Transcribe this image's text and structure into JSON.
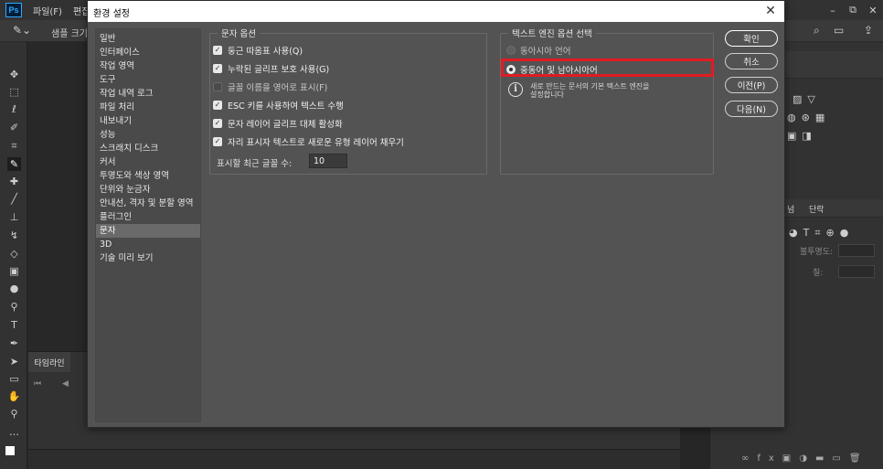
{
  "app": {
    "logo": "Ps",
    "menu": [
      "파일(F)",
      "편집"
    ],
    "window_controls": [
      "–",
      "⧉",
      "✕"
    ],
    "options_bar": {
      "sample_label": "샘플 크기",
      "tool_icon": "eyedropper-icon"
    }
  },
  "timeline": {
    "tab_label": "타임라인",
    "controls": "⏮ ◀ ▶"
  },
  "right_panel": {
    "tab_char_label": "단락",
    "tab_layers_label": "넘",
    "opacity_label": "불투명도:",
    "fill_label": "칠:"
  },
  "dialog": {
    "title": "환경 설정",
    "close_glyph": "✕",
    "nav_items": [
      "일반",
      "인터페이스",
      "작업 영역",
      "도구",
      "작업 내역 로그",
      "파일 처리",
      "내보내기",
      "성능",
      "스크래치 디스크",
      "커서",
      "투명도와 색상 영역",
      "단위와 눈금자",
      "안내선, 격자 및 분할 영역",
      "플러그인",
      "문자",
      "3D",
      "기술 미리 보기"
    ],
    "nav_selected_index": 14,
    "text_options": {
      "legend": "문자 옵션",
      "checkboxes": [
        {
          "label": "둥근 따옴표 사용(Q)",
          "checked": true
        },
        {
          "label": "누락된 글리프 보호 사용(G)",
          "checked": true
        },
        {
          "label": "글꼴 이름을 영어로 표시(F)",
          "checked": false
        },
        {
          "label": "ESC 키를 사용하여 텍스트 수행",
          "checked": true
        },
        {
          "label": "문자 레이어 글리프 대체 활성화",
          "checked": true
        },
        {
          "label": "자리 표시자 텍스트로 새로운 유형 레이어 채우기",
          "checked": true
        }
      ],
      "recent_fonts_label": "표시할 최근 글꼴 수:",
      "recent_fonts_value": "10"
    },
    "text_engine": {
      "legend": "텍스트 엔진 옵션 선택",
      "options": [
        {
          "label": "동아시아 언어",
          "selected": false
        },
        {
          "label": "중동어 및 남아시아어",
          "selected": true
        }
      ],
      "info_text": "새로 만드는 문서의 기본 텍스트 엔진을 설정합니다"
    },
    "buttons": {
      "ok": "확인",
      "cancel": "취소",
      "prev": "이전(P)",
      "next": "다음(N)"
    }
  },
  "colors": {
    "highlight": "#e01b24",
    "dialog_bg": "#535353",
    "app_bg": "#262626"
  }
}
